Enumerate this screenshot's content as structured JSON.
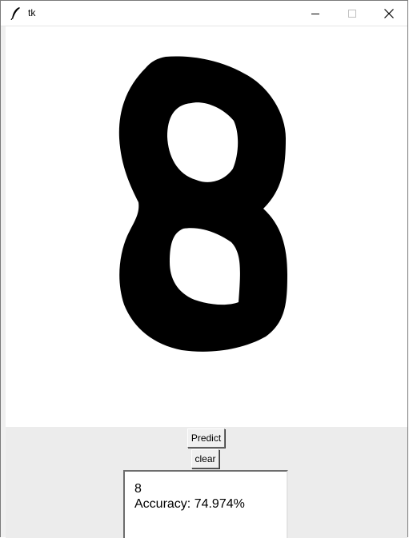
{
  "window": {
    "title": "tk",
    "icons": {
      "app": "feather-icon",
      "minimize": "minimize-icon",
      "maximize": "maximize-icon",
      "close": "close-icon"
    }
  },
  "canvas": {
    "content": "handwritten digit 8",
    "stroke_color": "#000000",
    "background": "#ffffff"
  },
  "buttons": {
    "predict_label": "Predict",
    "clear_label": "clear"
  },
  "result": {
    "prediction": "8",
    "accuracy": "Accuracy: 74.974%"
  }
}
